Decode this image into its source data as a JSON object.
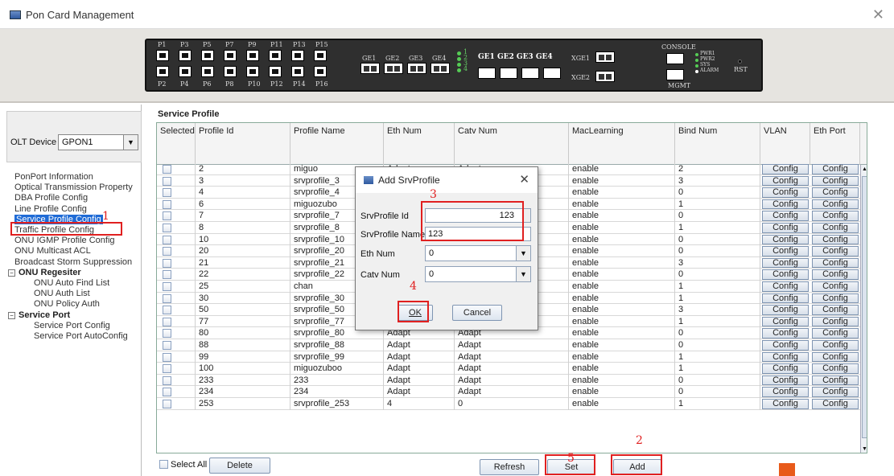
{
  "window": {
    "title": "Pon Card Management",
    "close": "✕"
  },
  "device": {
    "top_labels": [
      "P1",
      "P3",
      "P5",
      "P7",
      "P9",
      "P11",
      "P13",
      "P15"
    ],
    "bottom_labels": [
      "P2",
      "P4",
      "P6",
      "P8",
      "P10",
      "P12",
      "P14",
      "P16"
    ],
    "ge_sfp_labels": [
      "GE1",
      "GE2",
      "GE3",
      "GE4"
    ],
    "led_nums": [
      "1",
      "2",
      "3",
      "4"
    ],
    "ge_rj45_label": "GE1 GE2 GE3 GE4",
    "xge": [
      "XGE1",
      "XGE2"
    ],
    "console": "CONSOLE",
    "mgmt": "MGMT",
    "status": [
      "PWR1",
      "PWR2",
      "SYS",
      "ALARM"
    ],
    "rst": "RST"
  },
  "sidebar": {
    "olt_label": "OLT Device",
    "olt_value": "GPON1",
    "items": [
      "PonPort Information",
      "Optical Transmission Property",
      "DBA Profile Config",
      "Line Profile Config",
      "Service Profile Config",
      "Traffic Profile Config",
      "ONU IGMP Profile Config",
      "ONU Multicast ACL",
      "Broadcast Storm Suppression"
    ],
    "group_onu": "ONU Regesiter",
    "onu_items": [
      "ONU Auto Find List",
      "ONU Auth List",
      "ONU Policy Auth"
    ],
    "group_service": "Service Port",
    "service_items": [
      "Service Port Config",
      "Service Port AutoConfig"
    ]
  },
  "main": {
    "section_title": "Service Profile",
    "columns": [
      "Selected",
      "Profile Id",
      "Profile Name",
      "Eth Num",
      "Catv Num",
      "MacLearning",
      "Bind Num",
      "VLAN",
      "Eth Port"
    ],
    "config_label": "Config",
    "rows": [
      [
        "2",
        "miguo",
        "Adapt",
        "Adapt",
        "enable",
        "2"
      ],
      [
        "3",
        "srvprofile_3",
        "",
        "",
        "enable",
        "3"
      ],
      [
        "4",
        "srvprofile_4",
        "",
        "",
        "enable",
        "0"
      ],
      [
        "6",
        "miguozubo",
        "",
        "",
        "enable",
        "1"
      ],
      [
        "7",
        "srvprofile_7",
        "",
        "",
        "enable",
        "0"
      ],
      [
        "8",
        "srvprofile_8",
        "",
        "",
        "enable",
        "1"
      ],
      [
        "10",
        "srvprofile_10",
        "",
        "",
        "enable",
        "0"
      ],
      [
        "20",
        "srvprofile_20",
        "",
        "",
        "enable",
        "0"
      ],
      [
        "21",
        "srvprofile_21",
        "",
        "",
        "enable",
        "3"
      ],
      [
        "22",
        "srvprofile_22",
        "",
        "",
        "enable",
        "0"
      ],
      [
        "25",
        "chan",
        "",
        "",
        "enable",
        "1"
      ],
      [
        "30",
        "srvprofile_30",
        "",
        "",
        "enable",
        "1"
      ],
      [
        "50",
        "srvprofile_50",
        "Adapt",
        "Adapt",
        "enable",
        "3"
      ],
      [
        "77",
        "srvprofile_77",
        "Adapt",
        "Adapt",
        "enable",
        "1"
      ],
      [
        "80",
        "srvprofile_80",
        "Adapt",
        "Adapt",
        "enable",
        "0"
      ],
      [
        "88",
        "srvprofile_88",
        "Adapt",
        "Adapt",
        "enable",
        "0"
      ],
      [
        "99",
        "srvprofile_99",
        "Adapt",
        "Adapt",
        "enable",
        "1"
      ],
      [
        "100",
        "miguozuboo",
        "Adapt",
        "Adapt",
        "enable",
        "1"
      ],
      [
        "233",
        "233",
        "Adapt",
        "Adapt",
        "enable",
        "0"
      ],
      [
        "234",
        "234",
        "Adapt",
        "Adapt",
        "enable",
        "0"
      ],
      [
        "253",
        "srvprofile_253",
        "4",
        "0",
        "enable",
        "1"
      ]
    ],
    "select_all": "Select All",
    "delete": "Delete",
    "refresh": "Refresh",
    "set": "Set",
    "add": "Add"
  },
  "dialog": {
    "title": "Add SrvProfile",
    "close": "✕",
    "id_label": "SrvProfile Id",
    "id_value": "123",
    "name_label": "SrvProfile Name",
    "name_value": "123",
    "eth_label": "Eth Num",
    "eth_value": "0",
    "catv_label": "Catv Num",
    "catv_value": "0",
    "ok": "OK",
    "cancel": "Cancel"
  },
  "annotations": [
    "1",
    "2",
    "3",
    "4",
    "5"
  ],
  "accent_red": "#e02020"
}
